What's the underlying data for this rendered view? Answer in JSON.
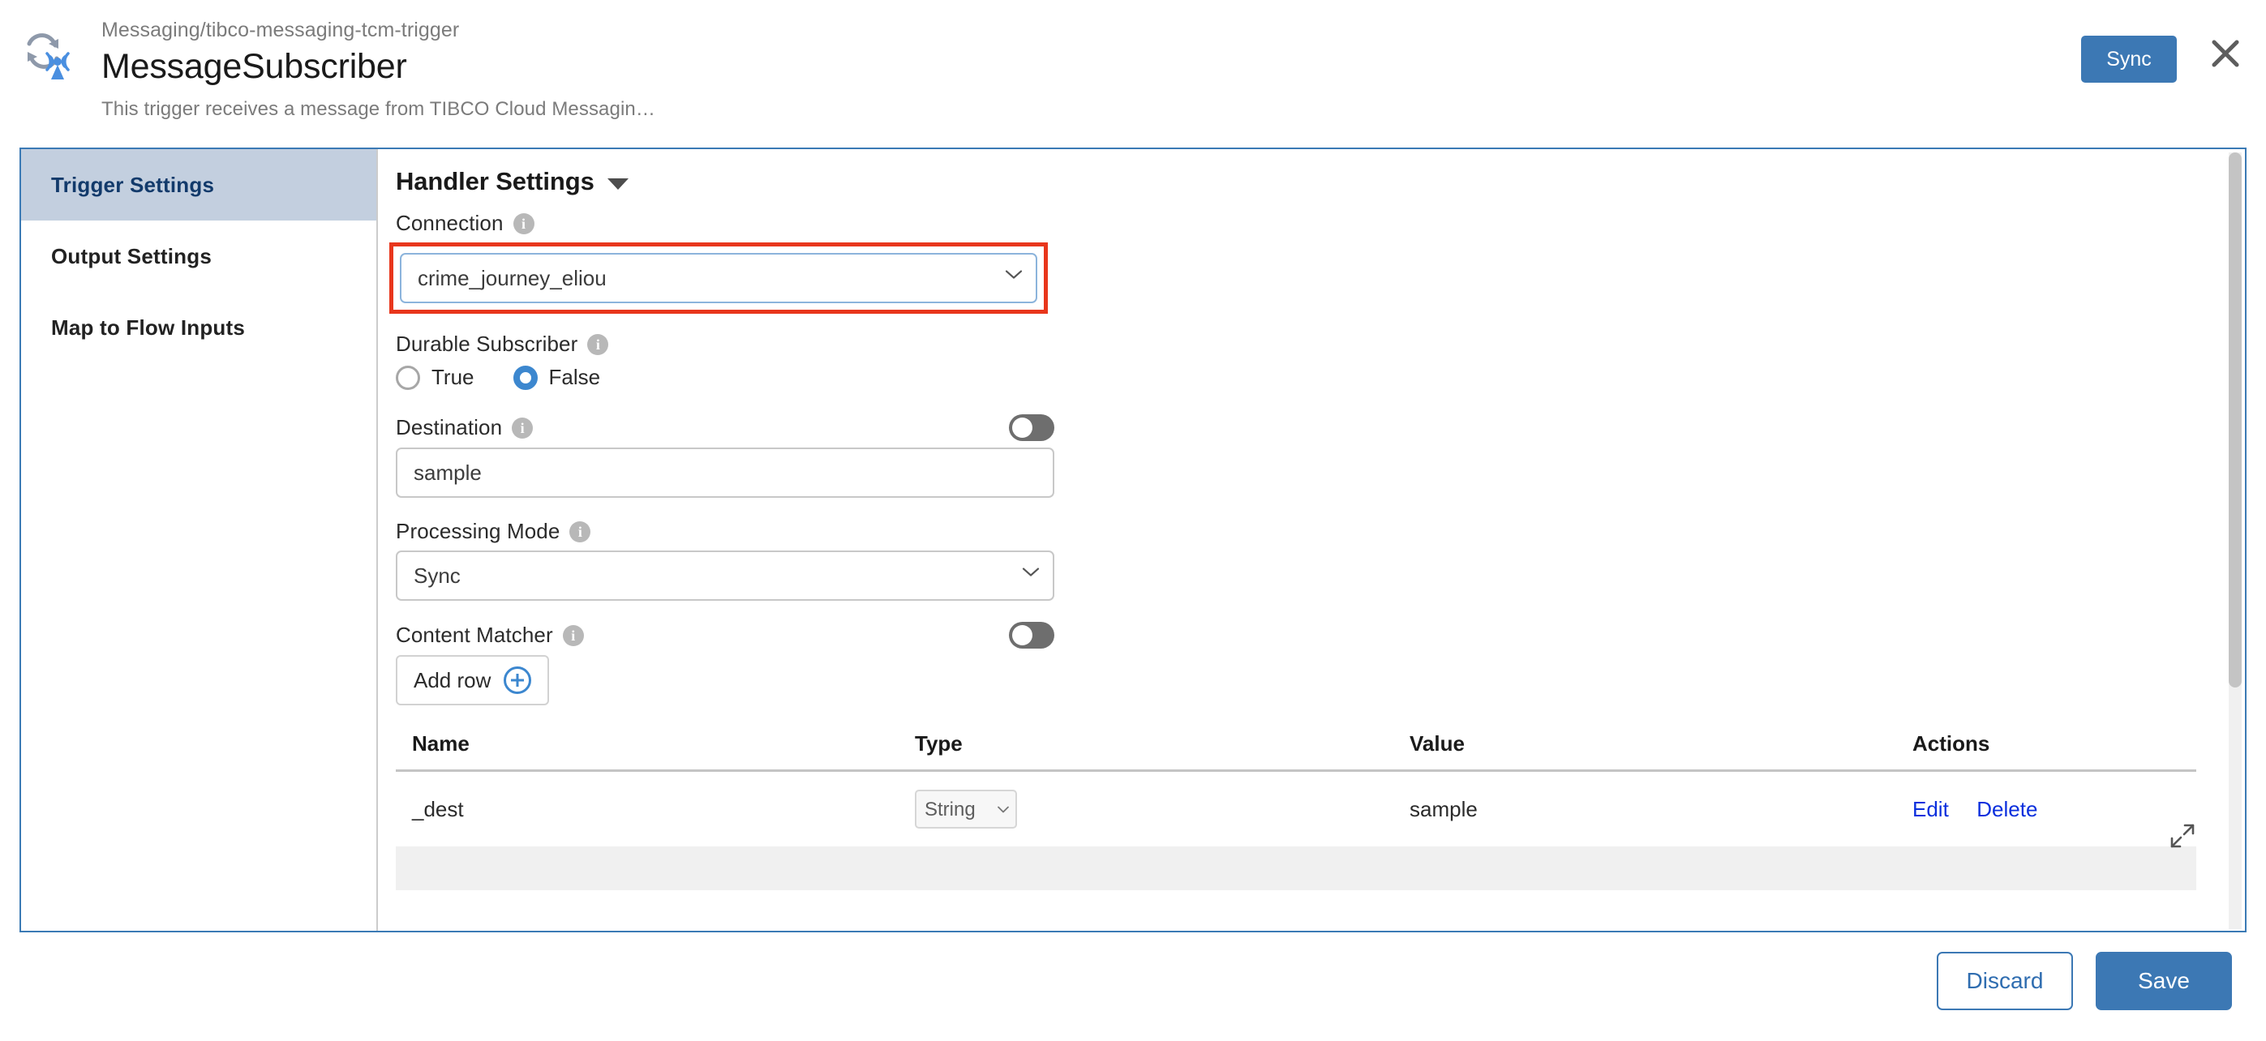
{
  "header": {
    "breadcrumb": "Messaging/tibco-messaging-tcm-trigger",
    "title": "MessageSubscriber",
    "description": "This trigger receives a message from TIBCO Cloud Messagin…",
    "sync_label": "Sync",
    "icon": "refresh-broadcast-icon",
    "close_icon": "close-icon"
  },
  "sidebar": {
    "items": [
      {
        "label": "Trigger Settings",
        "active": true
      },
      {
        "label": "Output Settings",
        "active": false
      },
      {
        "label": "Map to Flow Inputs",
        "active": false
      }
    ]
  },
  "main": {
    "section_title": "Handler Settings",
    "connection": {
      "label": "Connection",
      "value": "crime_journey_eliou",
      "options": [
        "crime_journey_eliou"
      ],
      "highlighted": true,
      "highlight_color": "#e8361c"
    },
    "durable_subscriber": {
      "label": "Durable Subscriber",
      "options": [
        {
          "label": "True",
          "selected": false
        },
        {
          "label": "False",
          "selected": true
        }
      ]
    },
    "destination": {
      "label": "Destination",
      "value": "sample",
      "placeholder": "",
      "toggle_on": false
    },
    "processing_mode": {
      "label": "Processing Mode",
      "value": "Sync",
      "options": [
        "Sync"
      ]
    },
    "content_matcher": {
      "label": "Content Matcher",
      "toggle_on": false,
      "add_row_label": "Add row"
    },
    "table": {
      "columns": [
        "Name",
        "Type",
        "Value",
        "Actions"
      ],
      "rows": [
        {
          "name": "_dest",
          "type": "String",
          "type_options": [
            "String"
          ],
          "value": "sample",
          "edit_label": "Edit",
          "delete_label": "Delete"
        }
      ]
    }
  },
  "footer": {
    "discard_label": "Discard",
    "save_label": "Save"
  },
  "colors": {
    "accent": "#3c78b4",
    "highlight": "#e8361c",
    "sidebar_active_bg": "#c3cfdf",
    "link": "#0a2fdd"
  }
}
